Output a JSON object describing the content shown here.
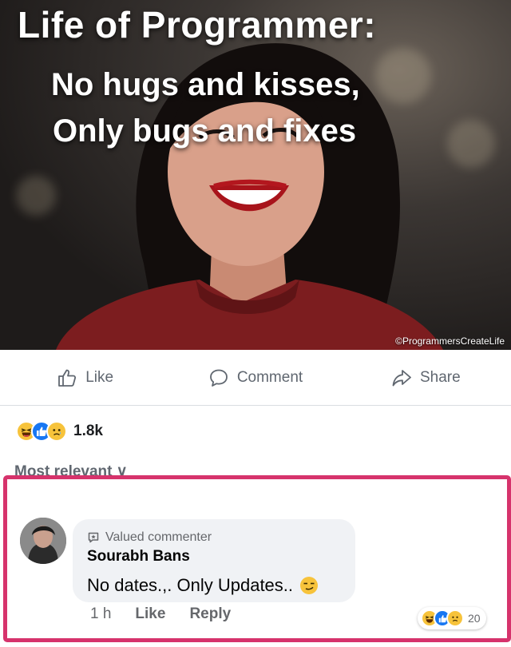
{
  "meme": {
    "title": "Life of Programmer:",
    "line1": "No hugs and kisses,",
    "line2": "Only bugs and fixes",
    "watermark": "©ProgrammersCreateLife"
  },
  "actions": {
    "like": "Like",
    "comment": "Comment",
    "share": "Share"
  },
  "reactions": {
    "icons": [
      "haha-icon",
      "like-icon",
      "sad-icon"
    ],
    "count": "1.8k"
  },
  "sort_label": "Most relevant ∨",
  "comment": {
    "badge": "Valued commenter",
    "author": "Sourabh Bans",
    "text": "No dates.,. Only Updates..",
    "emoji": "smirk-emoji",
    "reactions": {
      "icons": [
        "haha-icon",
        "like-icon",
        "sad-icon"
      ],
      "count": "20"
    },
    "time": "1 h",
    "like": "Like",
    "reply": "Reply"
  },
  "colors": {
    "highlight_border": "#d6336c",
    "facebook_blue": "#1877f2",
    "muted_text": "#606770",
    "bubble_bg": "#f0f2f5"
  }
}
